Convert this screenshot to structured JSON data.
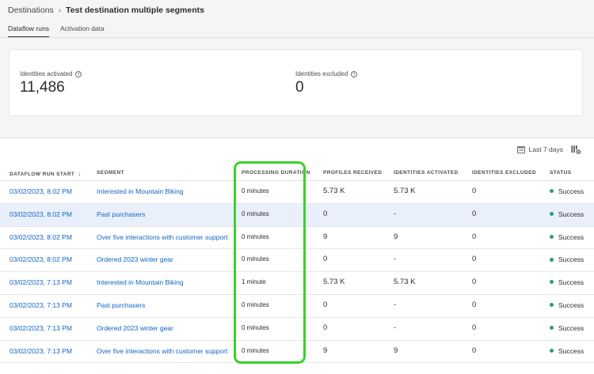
{
  "breadcrumb": {
    "parent": "Destinations",
    "separator": "›",
    "current": "Test destination multiple segments"
  },
  "tabs": [
    {
      "label": "Dataflow runs",
      "active": true
    },
    {
      "label": "Activation data",
      "active": false
    }
  ],
  "metrics": {
    "activated": {
      "label": "Identities activated",
      "value": "11,486"
    },
    "excluded": {
      "label": "Identities excluded",
      "value": "0"
    }
  },
  "toolbar": {
    "date_range_label": "Last 7 days",
    "calendar_icon": "calendar-icon",
    "column_settings_icon": "column-settings-icon"
  },
  "table": {
    "headers": {
      "run_start": "DATAFLOW RUN START",
      "segment": "SEGMENT",
      "duration": "PROCESSING DURATION",
      "profiles": "PROFILES RECEIVED",
      "activated": "IDENTITIES ACTIVATED",
      "excluded": "IDENTITIES EXCLUDED",
      "status": "STATUS"
    },
    "sort_icon": "arrow-down-icon",
    "rows": [
      {
        "run_start": "03/02/2023, 8:02 PM",
        "segment": "Interested in Mountain Biking",
        "duration": "0 minutes",
        "profiles": "5.73 K",
        "activated": "5.73 K",
        "excluded": "0",
        "status": "Success"
      },
      {
        "run_start": "03/02/2023, 8:02 PM",
        "segment": "Past purchasers",
        "duration": "0 minutes",
        "profiles": "0",
        "activated": "-",
        "excluded": "0",
        "status": "Success"
      },
      {
        "run_start": "03/02/2023, 8:02 PM",
        "segment": "Over five interactions with customer support",
        "duration": "0 minutes",
        "profiles": "9",
        "activated": "9",
        "excluded": "0",
        "status": "Success"
      },
      {
        "run_start": "03/02/2023, 8:02 PM",
        "segment": "Ordered 2023 winter gear",
        "duration": "0 minutes",
        "profiles": "0",
        "activated": "-",
        "excluded": "0",
        "status": "Success"
      },
      {
        "run_start": "03/02/2023, 7:13 PM",
        "segment": "Interested in Mountain Biking",
        "duration": "1 minute",
        "profiles": "5.73 K",
        "activated": "5.73 K",
        "excluded": "0",
        "status": "Success"
      },
      {
        "run_start": "03/02/2023, 7:13 PM",
        "segment": "Past purchasers",
        "duration": "0 minutes",
        "profiles": "0",
        "activated": "-",
        "excluded": "0",
        "status": "Success"
      },
      {
        "run_start": "03/02/2023, 7:13 PM",
        "segment": "Ordered 2023 winter gear",
        "duration": "0 minutes",
        "profiles": "0",
        "activated": "-",
        "excluded": "0",
        "status": "Success"
      },
      {
        "run_start": "03/02/2023, 7:13 PM",
        "segment": "Over five interactions with customer support",
        "duration": "0 minutes",
        "profiles": "9",
        "activated": "9",
        "excluded": "0",
        "status": "Success"
      }
    ],
    "selected_row": 1
  },
  "colors": {
    "link": "#1065c4",
    "success": "#2d9d78",
    "highlight": "#3ad12a",
    "selected_row": "#e9f0fb"
  }
}
